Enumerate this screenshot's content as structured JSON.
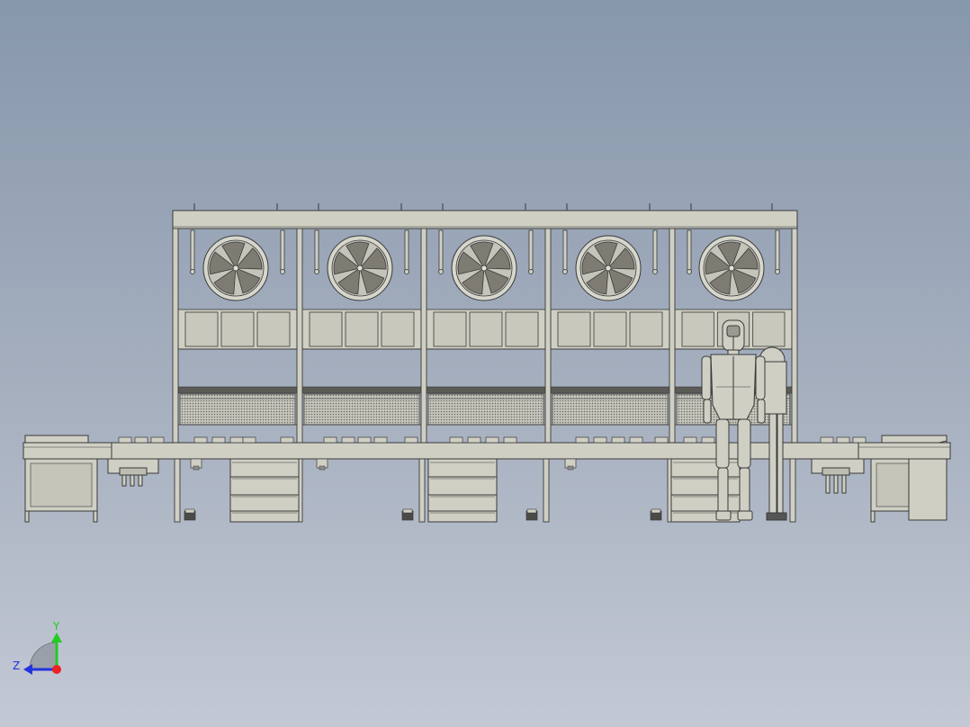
{
  "colors": {
    "background_top": "#8797ac",
    "background_bottom": "#c3c8d4",
    "frame_fill": "#cfcfc4",
    "frame_stroke": "#3a3a3a",
    "fan_blade": "#7e7c72",
    "mesh": "#a9a9a1",
    "axis_y": "#22cc22",
    "axis_z": "#2233dd",
    "axis_x": "#ee2222"
  },
  "view_triad": {
    "y_label": "Y",
    "z_label": "Z"
  }
}
